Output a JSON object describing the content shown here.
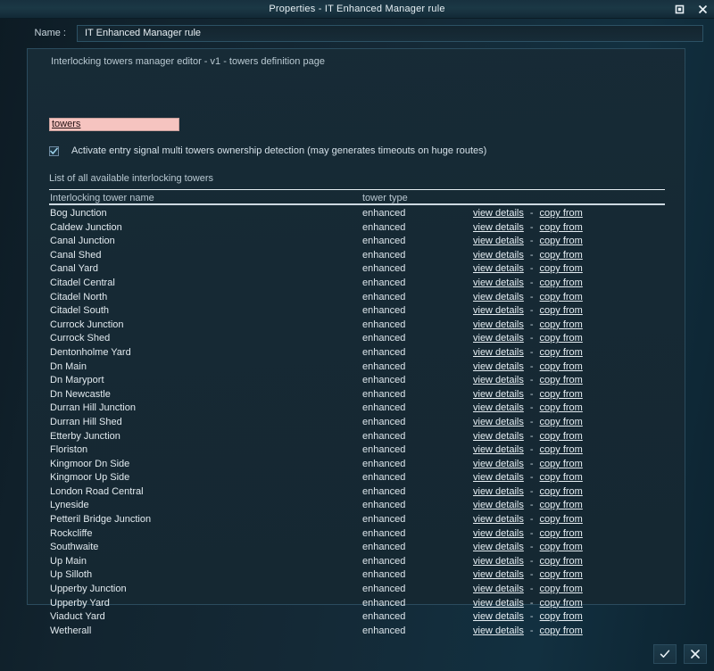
{
  "window": {
    "title": "Properties - IT Enhanced Manager rule",
    "maximize_icon": "maximize-icon",
    "close_icon": "close-icon"
  },
  "name_field": {
    "label": "Name :",
    "value": "IT Enhanced Manager rule",
    "placeholder": "Name"
  },
  "panel": {
    "editor_title": "Interlocking towers manager editor - v1 - towers definition page",
    "scope_input": {
      "value": "towers",
      "placeholder": "towers",
      "background_color": "#f6c4c0"
    },
    "checkbox": {
      "checked": true,
      "label": "Activate entry signal multi towers ownership detection (may generates timeouts on huge routes)"
    },
    "list_caption": "List of all available interlocking towers"
  },
  "table": {
    "columns": [
      "Interlocking tower name",
      "tower type"
    ],
    "actions": {
      "view": "view details",
      "separator": "-",
      "copy": "copy from"
    },
    "rows": [
      {
        "name": "Bog Junction",
        "type": "enhanced"
      },
      {
        "name": "Caldew Junction",
        "type": "enhanced"
      },
      {
        "name": "Canal Junction",
        "type": "enhanced"
      },
      {
        "name": "Canal Shed",
        "type": "enhanced"
      },
      {
        "name": "Canal Yard",
        "type": "enhanced"
      },
      {
        "name": "Citadel Central",
        "type": "enhanced"
      },
      {
        "name": "Citadel North",
        "type": "enhanced"
      },
      {
        "name": "Citadel South",
        "type": "enhanced"
      },
      {
        "name": "Currock Junction",
        "type": "enhanced"
      },
      {
        "name": "Currock Shed",
        "type": "enhanced"
      },
      {
        "name": "Dentonholme Yard",
        "type": "enhanced"
      },
      {
        "name": "Dn Main",
        "type": "enhanced"
      },
      {
        "name": "Dn Maryport",
        "type": "enhanced"
      },
      {
        "name": "Dn Newcastle",
        "type": "enhanced"
      },
      {
        "name": "Durran Hill Junction",
        "type": "enhanced"
      },
      {
        "name": "Durran Hill Shed",
        "type": "enhanced"
      },
      {
        "name": "Etterby Junction",
        "type": "enhanced"
      },
      {
        "name": "Floriston",
        "type": "enhanced"
      },
      {
        "name": "Kingmoor Dn Side",
        "type": "enhanced"
      },
      {
        "name": "Kingmoor Up Side",
        "type": "enhanced"
      },
      {
        "name": "London Road Central",
        "type": "enhanced"
      },
      {
        "name": "Lyneside",
        "type": "enhanced"
      },
      {
        "name": "Petteril Bridge Junction",
        "type": "enhanced"
      },
      {
        "name": "Rockcliffe",
        "type": "enhanced"
      },
      {
        "name": "Southwaite",
        "type": "enhanced"
      },
      {
        "name": "Up Main",
        "type": "enhanced"
      },
      {
        "name": "Up Silloth",
        "type": "enhanced"
      },
      {
        "name": "Upperby Junction",
        "type": "enhanced"
      },
      {
        "name": "Upperby Yard",
        "type": "enhanced"
      },
      {
        "name": "Viaduct Yard",
        "type": "enhanced"
      },
      {
        "name": "Wetherall",
        "type": "enhanced"
      }
    ]
  },
  "footer": {
    "confirm_icon": "check-icon",
    "cancel_icon": "close-icon"
  }
}
